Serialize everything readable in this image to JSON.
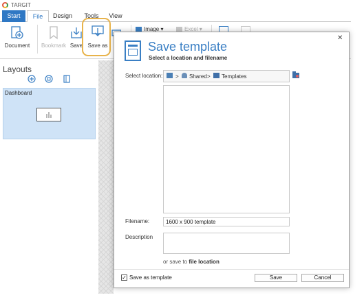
{
  "app": {
    "title": "TARGIT"
  },
  "tabs": [
    {
      "label": "Start"
    },
    {
      "label": "File"
    },
    {
      "label": "Design"
    },
    {
      "label": "Tools"
    },
    {
      "label": "View"
    }
  ],
  "ribbon": {
    "document": "Document",
    "bookmark": "Bookmark",
    "save": "Save",
    "save_as": "Save as",
    "image": "Image",
    "excel": "Excel"
  },
  "layouts": {
    "title": "Layouts",
    "tile_label": "Dashboard"
  },
  "dialog": {
    "title": "Save template",
    "subtitle": "Select a location and filename",
    "select_location_label": "Select location:",
    "crumbs": [
      "Shared",
      "Templates"
    ],
    "filename_label": "Filename:",
    "filename_value": "1600 x 900 template",
    "description_label": "Description",
    "or_save_to": "or save to",
    "file_location": "file location",
    "save_as_template": "Save as template",
    "save_button": "Save",
    "cancel_button": "Cancel"
  },
  "colors": {
    "accent": "#2f78c4",
    "highlight": "#e8b34a",
    "tile": "#cfe3f7"
  }
}
